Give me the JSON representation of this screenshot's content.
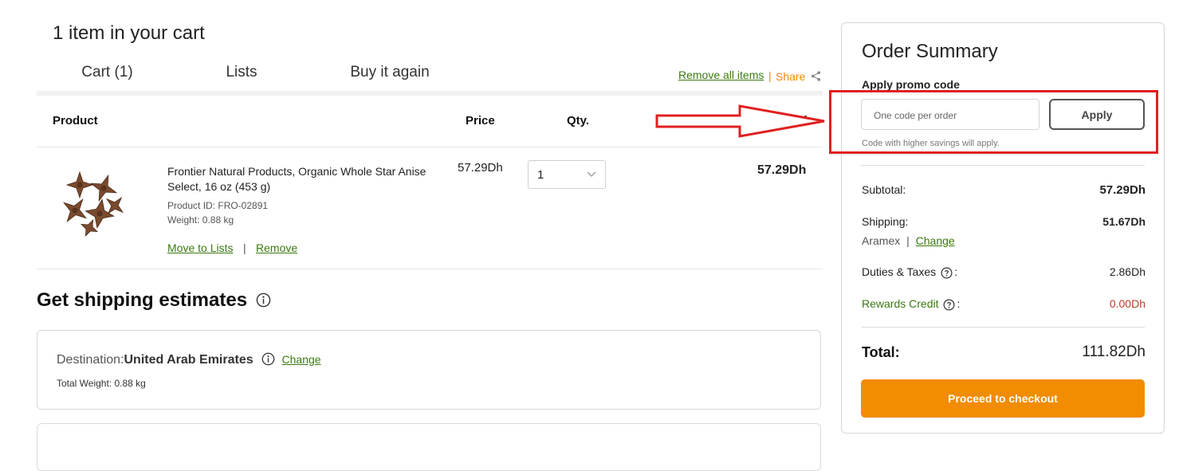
{
  "cart": {
    "title": "1 item in your cart",
    "tabs": [
      {
        "label": "Cart (1)"
      },
      {
        "label": "Lists"
      },
      {
        "label": "Buy it again"
      }
    ],
    "remove_all_label": "Remove all items",
    "separator": "|",
    "share_label": "Share",
    "columns": {
      "product": "Product",
      "price": "Price",
      "qty": "Qty.",
      "total": "Total"
    },
    "items": [
      {
        "name": "Frontier Natural Products, Organic Whole Star Anise Select, 16 oz (453 g)",
        "product_id": "Product ID: FRO-02891",
        "weight": "Weight: 0.88 kg",
        "price": "57.29Dh",
        "qty": "1",
        "total": "57.29Dh",
        "move_label": "Move to Lists",
        "remove_label": "Remove"
      }
    ]
  },
  "shipping": {
    "title": "Get shipping estimates",
    "destination_label": "Destination:",
    "destination_value": "United Arab Emirates",
    "change_label": "Change",
    "total_weight": "Total Weight: 0.88 kg"
  },
  "summary": {
    "title": "Order Summary",
    "promo_label": "Apply promo code",
    "promo_placeholder": "One code per order",
    "apply_label": "Apply",
    "promo_note": "Code with higher savings will apply.",
    "subtotal_label": "Subtotal:",
    "subtotal_value": "57.29Dh",
    "shipping_label": "Shipping:",
    "shipping_value": "51.67Dh",
    "carrier": "Aramex",
    "carrier_sep": "|",
    "change_label": "Change",
    "duties_label": "Duties & Taxes",
    "duties_value": "2.86Dh",
    "rewards_label": "Rewards Credit",
    "rewards_value": "0.00Dh",
    "colon": ":",
    "total_label": "Total:",
    "total_value": "111.82Dh",
    "checkout_label": "Proceed to checkout"
  },
  "colors": {
    "accent_green": "#5a9e1b",
    "link_green": "#3a7a10",
    "orange": "#f28c00",
    "annotation_red": "#e02020"
  }
}
